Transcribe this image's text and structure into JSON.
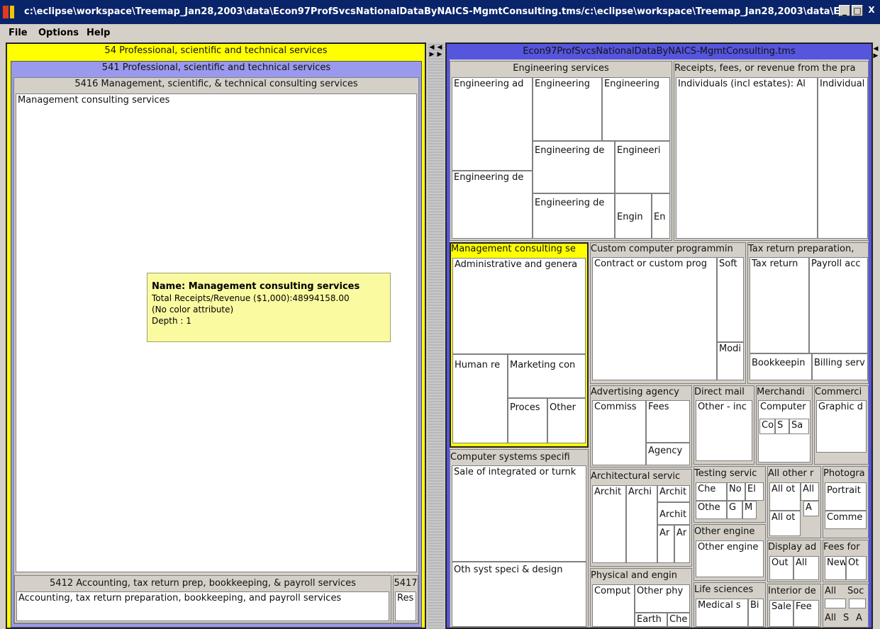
{
  "window": {
    "title": "c:\\eclipse\\workspace\\Treemap_Jan28,2003\\data\\Econ97ProfSvcsNationalDataByNAICS-MgmtConsulting.tms/c:\\eclipse\\workspace\\Treemap_Jan28,2003\\data\\Ec...",
    "buttons": {
      "minimize": "_",
      "maximize": "□",
      "close": "X"
    }
  },
  "menu": {
    "items": [
      "File",
      "Options",
      "Help"
    ]
  },
  "left": {
    "level1": "54 Professional, scientific and technical services",
    "level2": "541 Professional, scientific and technical services",
    "level3": "5416 Management, scientific, & technical consulting services",
    "leaf_main": "Management consulting services",
    "acc_header": "5412 Accounting, tax return prep, bookkeeping, & payroll services",
    "acc_leaf": "Accounting, tax return preparation, bookkeeping, and payroll services",
    "small_header": "5417",
    "small_leaf": "Res",
    "tooltip": {
      "name": "Name: Management consulting services",
      "receipts": "Total Receipts/Revenue ($1,000):48994158.00",
      "color": "(No color attribute)",
      "depth": "Depth : 1"
    }
  },
  "right": {
    "root": "Econ97ProfSvcsNationalDataByNAICS-MgmtConsulting.tms",
    "eng": {
      "header": "Engineering services",
      "a": "Engineering ad",
      "b": "Engineering",
      "c": "Engineering",
      "d": "Engineering de",
      "e": "Engineering de",
      "f": "Engineeri",
      "g": "Engineering de",
      "h": "Engin",
      "i": "En"
    },
    "receipts": {
      "header": "Receipts, fees, or revenue from the pra",
      "a": "Individuals (incl estates): Al",
      "b": "Individual"
    },
    "mgmt": {
      "header": "Management consulting se",
      "a": "Administrative and genera",
      "b": "Human re",
      "c": "Marketing con",
      "d": "Proces",
      "e": "Other"
    },
    "custom": {
      "header": "Custom computer programmin",
      "a": "Contract or custom prog",
      "b": "Soft",
      "c": "Modi"
    },
    "tax": {
      "header": "Tax return preparation,",
      "a": "Tax return",
      "b": "Payroll acc",
      "c": "Bookkeepin",
      "d": "Billing serv"
    },
    "adv": {
      "header": "Advertising agency",
      "a": "Commiss",
      "b": "Fees",
      "c": "Agency"
    },
    "direct": {
      "header": "Direct mail",
      "a": "Other - inc"
    },
    "merch": {
      "header": "Merchandi",
      "a": "Computer",
      "b": "Co",
      "c": "S",
      "d": "Sa"
    },
    "commerci": {
      "header": "Commerci",
      "a": "Graphic d"
    },
    "compsys": {
      "header": "Computer systems specifi",
      "a": "Sale of integrated or turnk",
      "b": "Oth syst speci & design"
    },
    "arch": {
      "header": "Architectural servic",
      "a": "Archit",
      "b": "Archi",
      "c": "Archit",
      "d": "Archit",
      "e": "Ar",
      "f": "Ar"
    },
    "testing": {
      "header": "Testing servic",
      "a": "Che",
      "b": "No",
      "c": "El",
      "d": "Othe",
      "e": "G",
      "f": "M"
    },
    "allother": {
      "header": "All other r",
      "a": "All ot",
      "b": "All",
      "c": "A",
      "d": "All ot"
    },
    "photo": {
      "header": "Photogra",
      "a": "Portrait",
      "b": "Comme"
    },
    "othereng": {
      "header": "Other engine",
      "a": "Other engine"
    },
    "display": {
      "header": "Display ad",
      "a": "Out",
      "b": "All"
    },
    "feesfor": {
      "header": "Fees for",
      "a": "New",
      "b": "Ot"
    },
    "phys": {
      "header": "Physical and engin",
      "a": "Comput",
      "b": "Other phy",
      "c": "Earth",
      "d": "Che"
    },
    "life": {
      "header": "Life sciences",
      "a": "Medical s",
      "b": "Bi"
    },
    "interior": {
      "header": "Interior de",
      "a": "Sale",
      "b": "Fee"
    },
    "misc": {
      "a": "All",
      "b": "Soc",
      "c": "All",
      "d": "S",
      "e": "A"
    }
  },
  "colors": {
    "selected_yellow": "#ffff00",
    "level2_purple": "#9999ee",
    "root_blue": "#5555dd",
    "titlebar": "#0a246a"
  }
}
